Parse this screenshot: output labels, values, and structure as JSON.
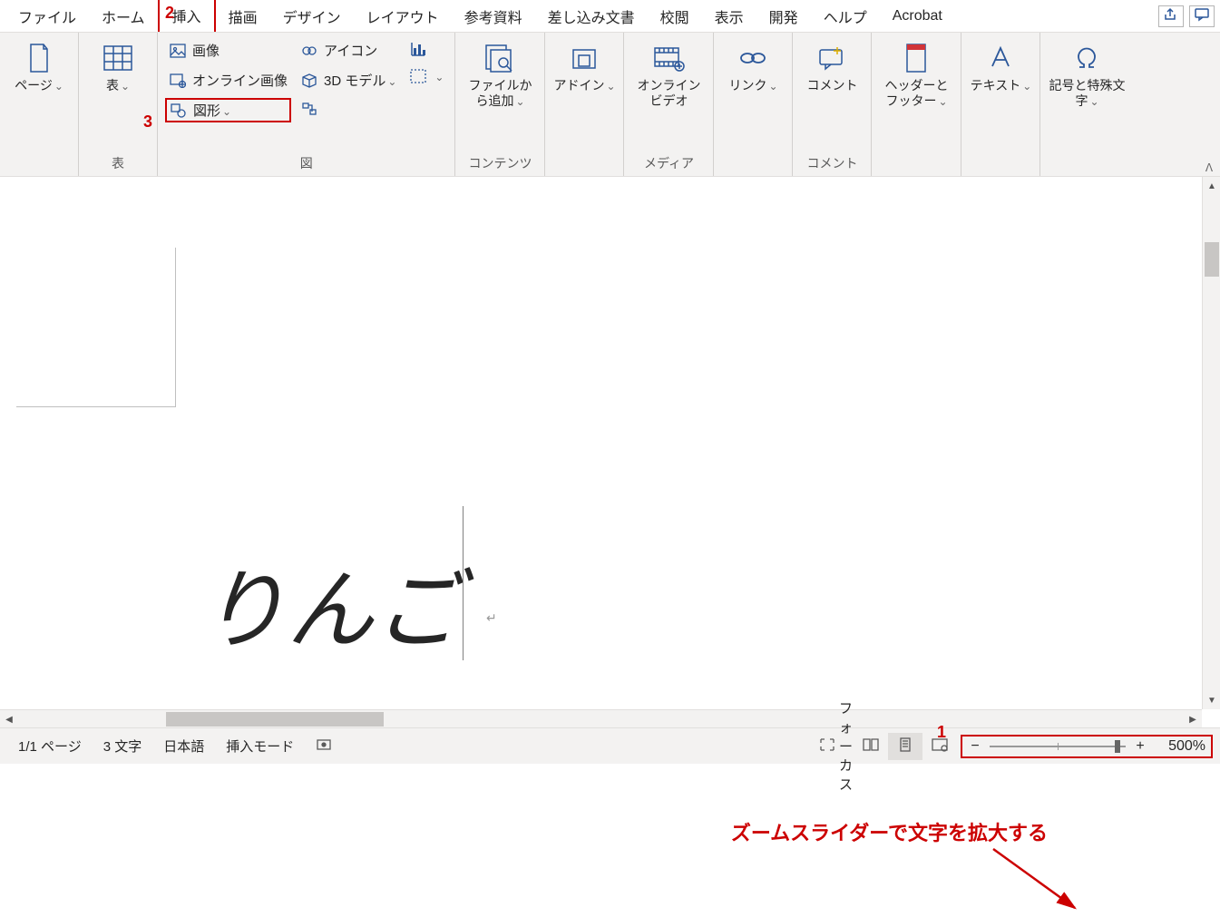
{
  "tabs": {
    "items": [
      "ファイル",
      "ホーム",
      "挿入",
      "描画",
      "デザイン",
      "レイアウト",
      "参考資料",
      "差し込み文書",
      "校閲",
      "表示",
      "開発",
      "ヘルプ",
      "Acrobat"
    ],
    "active_index": 2
  },
  "topbuttons": {
    "share": "共有",
    "comments": "コメント"
  },
  "ribbon": {
    "pages": {
      "label": "ページ",
      "button": "ページ"
    },
    "tables": {
      "label": "表",
      "button": "表"
    },
    "illustrations": {
      "label": "図",
      "picture": "画像",
      "online_pictures": "オンライン画像",
      "shapes": "図形",
      "icons": "アイコン",
      "models3d": "3D モデル",
      "smartart": "",
      "chart": "",
      "screenshot": ""
    },
    "contents": {
      "label": "コンテンツ",
      "fromfile": "ファイルから追加"
    },
    "addins": {
      "label": "",
      "button": "アドイン"
    },
    "media": {
      "label": "メディア",
      "button": "オンラインビデオ"
    },
    "links": {
      "label": "",
      "button": "リンク"
    },
    "comments": {
      "label": "コメント",
      "button": "コメント"
    },
    "headerfooter": {
      "label": "",
      "button": "ヘッダーとフッター"
    },
    "text": {
      "label": "",
      "button": "テキスト"
    },
    "symbols": {
      "label": "",
      "button": "記号と特殊文字"
    }
  },
  "document": {
    "text": "りんご"
  },
  "annotation": {
    "text": "ズームスライダーで文字を拡大する",
    "marks": {
      "m1": "1",
      "m2": "2",
      "m3": "3"
    }
  },
  "status": {
    "page": "1/1 ページ",
    "words": "3 文字",
    "lang": "日本語",
    "mode": "挿入モード",
    "focus": "フォーカス",
    "zoom_pct": "500%",
    "zoom_minus": "−",
    "zoom_plus": "+"
  }
}
